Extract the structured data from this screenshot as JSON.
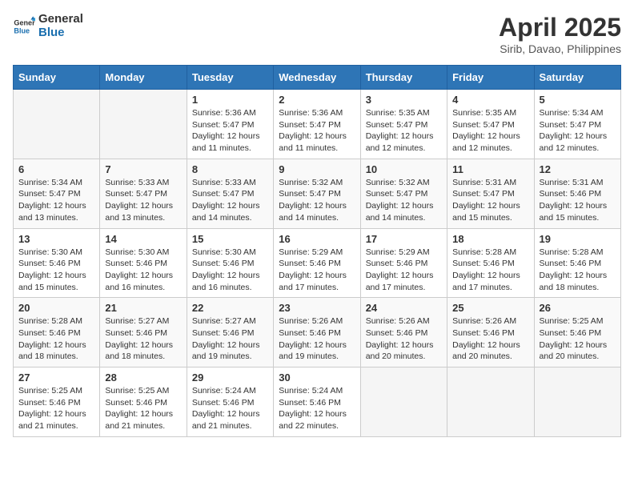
{
  "logo": {
    "general": "General",
    "blue": "Blue"
  },
  "title": "April 2025",
  "location": "Sirib, Davao, Philippines",
  "weekdays": [
    "Sunday",
    "Monday",
    "Tuesday",
    "Wednesday",
    "Thursday",
    "Friday",
    "Saturday"
  ],
  "weeks": [
    [
      {
        "day": "",
        "info": ""
      },
      {
        "day": "",
        "info": ""
      },
      {
        "day": "1",
        "info": "Sunrise: 5:36 AM\nSunset: 5:47 PM\nDaylight: 12 hours and 11 minutes."
      },
      {
        "day": "2",
        "info": "Sunrise: 5:36 AM\nSunset: 5:47 PM\nDaylight: 12 hours and 11 minutes."
      },
      {
        "day": "3",
        "info": "Sunrise: 5:35 AM\nSunset: 5:47 PM\nDaylight: 12 hours and 12 minutes."
      },
      {
        "day": "4",
        "info": "Sunrise: 5:35 AM\nSunset: 5:47 PM\nDaylight: 12 hours and 12 minutes."
      },
      {
        "day": "5",
        "info": "Sunrise: 5:34 AM\nSunset: 5:47 PM\nDaylight: 12 hours and 12 minutes."
      }
    ],
    [
      {
        "day": "6",
        "info": "Sunrise: 5:34 AM\nSunset: 5:47 PM\nDaylight: 12 hours and 13 minutes."
      },
      {
        "day": "7",
        "info": "Sunrise: 5:33 AM\nSunset: 5:47 PM\nDaylight: 12 hours and 13 minutes."
      },
      {
        "day": "8",
        "info": "Sunrise: 5:33 AM\nSunset: 5:47 PM\nDaylight: 12 hours and 14 minutes."
      },
      {
        "day": "9",
        "info": "Sunrise: 5:32 AM\nSunset: 5:47 PM\nDaylight: 12 hours and 14 minutes."
      },
      {
        "day": "10",
        "info": "Sunrise: 5:32 AM\nSunset: 5:47 PM\nDaylight: 12 hours and 14 minutes."
      },
      {
        "day": "11",
        "info": "Sunrise: 5:31 AM\nSunset: 5:47 PM\nDaylight: 12 hours and 15 minutes."
      },
      {
        "day": "12",
        "info": "Sunrise: 5:31 AM\nSunset: 5:46 PM\nDaylight: 12 hours and 15 minutes."
      }
    ],
    [
      {
        "day": "13",
        "info": "Sunrise: 5:30 AM\nSunset: 5:46 PM\nDaylight: 12 hours and 15 minutes."
      },
      {
        "day": "14",
        "info": "Sunrise: 5:30 AM\nSunset: 5:46 PM\nDaylight: 12 hours and 16 minutes."
      },
      {
        "day": "15",
        "info": "Sunrise: 5:30 AM\nSunset: 5:46 PM\nDaylight: 12 hours and 16 minutes."
      },
      {
        "day": "16",
        "info": "Sunrise: 5:29 AM\nSunset: 5:46 PM\nDaylight: 12 hours and 17 minutes."
      },
      {
        "day": "17",
        "info": "Sunrise: 5:29 AM\nSunset: 5:46 PM\nDaylight: 12 hours and 17 minutes."
      },
      {
        "day": "18",
        "info": "Sunrise: 5:28 AM\nSunset: 5:46 PM\nDaylight: 12 hours and 17 minutes."
      },
      {
        "day": "19",
        "info": "Sunrise: 5:28 AM\nSunset: 5:46 PM\nDaylight: 12 hours and 18 minutes."
      }
    ],
    [
      {
        "day": "20",
        "info": "Sunrise: 5:28 AM\nSunset: 5:46 PM\nDaylight: 12 hours and 18 minutes."
      },
      {
        "day": "21",
        "info": "Sunrise: 5:27 AM\nSunset: 5:46 PM\nDaylight: 12 hours and 18 minutes."
      },
      {
        "day": "22",
        "info": "Sunrise: 5:27 AM\nSunset: 5:46 PM\nDaylight: 12 hours and 19 minutes."
      },
      {
        "day": "23",
        "info": "Sunrise: 5:26 AM\nSunset: 5:46 PM\nDaylight: 12 hours and 19 minutes."
      },
      {
        "day": "24",
        "info": "Sunrise: 5:26 AM\nSunset: 5:46 PM\nDaylight: 12 hours and 20 minutes."
      },
      {
        "day": "25",
        "info": "Sunrise: 5:26 AM\nSunset: 5:46 PM\nDaylight: 12 hours and 20 minutes."
      },
      {
        "day": "26",
        "info": "Sunrise: 5:25 AM\nSunset: 5:46 PM\nDaylight: 12 hours and 20 minutes."
      }
    ],
    [
      {
        "day": "27",
        "info": "Sunrise: 5:25 AM\nSunset: 5:46 PM\nDaylight: 12 hours and 21 minutes."
      },
      {
        "day": "28",
        "info": "Sunrise: 5:25 AM\nSunset: 5:46 PM\nDaylight: 12 hours and 21 minutes."
      },
      {
        "day": "29",
        "info": "Sunrise: 5:24 AM\nSunset: 5:46 PM\nDaylight: 12 hours and 21 minutes."
      },
      {
        "day": "30",
        "info": "Sunrise: 5:24 AM\nSunset: 5:46 PM\nDaylight: 12 hours and 22 minutes."
      },
      {
        "day": "",
        "info": ""
      },
      {
        "day": "",
        "info": ""
      },
      {
        "day": "",
        "info": ""
      }
    ]
  ]
}
